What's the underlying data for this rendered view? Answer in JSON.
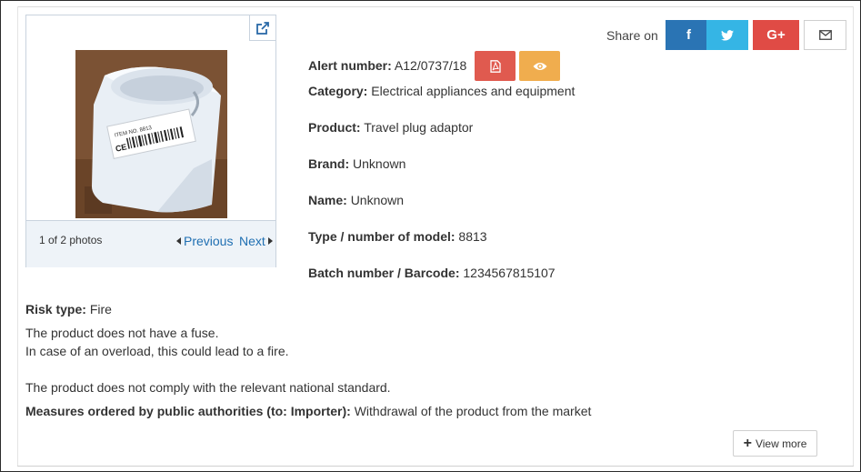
{
  "photo": {
    "count_label": "1 of 2 photos",
    "prev_label": "Previous",
    "next_label": "Next",
    "label_text": "ITEM NO. 8813"
  },
  "share": {
    "label": "Share on",
    "facebook_glyph": "f",
    "googleplus_glyph": "G+"
  },
  "details": {
    "alert": {
      "label": "Alert number:",
      "value": "A12/0737/18"
    },
    "category": {
      "label": "Category:",
      "value": "Electrical appliances and equipment"
    },
    "product": {
      "label": "Product:",
      "value": "Travel plug adaptor"
    },
    "brand": {
      "label": "Brand:",
      "value": "Unknown"
    },
    "name": {
      "label": "Name:",
      "value": "Unknown"
    },
    "type_model": {
      "label": "Type / number of model:",
      "value": "8813"
    },
    "batch": {
      "label": "Batch number / Barcode:",
      "value": "1234567815107"
    }
  },
  "risk": {
    "label": "Risk type:",
    "value": "Fire",
    "lines": [
      "The product does not have a fuse.",
      "In case of an overload, this could lead to a fire.",
      "The product does not comply with the relevant national standard."
    ]
  },
  "measures": {
    "label": "Measures ordered by public authorities (to: Importer):",
    "value": "Withdrawal of the product from the market"
  },
  "view_more_label": "View more",
  "colors": {
    "facebook": "#2a74b4",
    "twitter": "#35b5e5",
    "googleplus": "#e04b45",
    "pdf": "#e05a4f",
    "view": "#f0ad4e",
    "link": "#1f6fb2"
  },
  "icons": [
    "external-link-icon",
    "pdf-icon",
    "eye-icon",
    "caret-left-icon",
    "caret-right-icon",
    "facebook-icon",
    "twitter-icon",
    "google-plus-icon",
    "envelope-icon",
    "plus-icon"
  ]
}
